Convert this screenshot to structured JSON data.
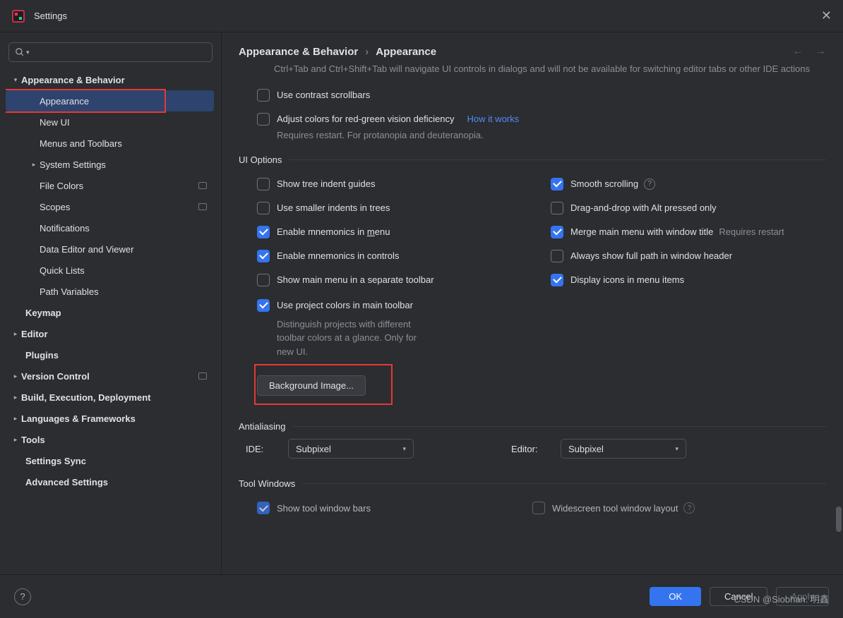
{
  "window": {
    "title": "Settings"
  },
  "breadcrumb": {
    "parent": "Appearance & Behavior",
    "child": "Appearance"
  },
  "sidebar": {
    "items": [
      {
        "label": "Appearance & Behavior"
      },
      {
        "label": "Appearance"
      },
      {
        "label": "New UI"
      },
      {
        "label": "Menus and Toolbars"
      },
      {
        "label": "System Settings"
      },
      {
        "label": "File Colors"
      },
      {
        "label": "Scopes"
      },
      {
        "label": "Notifications"
      },
      {
        "label": "Data Editor and Viewer"
      },
      {
        "label": "Quick Lists"
      },
      {
        "label": "Path Variables"
      },
      {
        "label": "Keymap"
      },
      {
        "label": "Editor"
      },
      {
        "label": "Plugins"
      },
      {
        "label": "Version Control"
      },
      {
        "label": "Build, Execution, Deployment"
      },
      {
        "label": "Languages & Frameworks"
      },
      {
        "label": "Tools"
      },
      {
        "label": "Settings Sync"
      },
      {
        "label": "Advanced Settings"
      }
    ]
  },
  "topHint": "Ctrl+Tab and Ctrl+Shift+Tab will navigate UI controls in dialogs and will not be available for switching editor tabs or other IDE actions",
  "checks": {
    "contrastScrollbars": "Use contrast scrollbars",
    "adjustColors": "Adjust colors for red-green vision deficiency",
    "howItWorks": "How it works",
    "adjustHint": "Requires restart. For protanopia and deuteranopia."
  },
  "sections": {
    "uiOptions": "UI Options",
    "antialiasing": "Antialiasing",
    "toolWindows": "Tool Windows"
  },
  "uiOptions": {
    "left": [
      {
        "label": "Show tree indent guides",
        "checked": false
      },
      {
        "label": "Use smaller indents in trees",
        "checked": false
      },
      {
        "label_pre": "Enable mnemonics in ",
        "underline": "m",
        "label_post": "enu",
        "checked": true
      },
      {
        "label": "Enable mnemonics in controls",
        "checked": true
      },
      {
        "label": "Show main menu in a separate toolbar",
        "checked": false
      },
      {
        "label": "Use project colors in main toolbar",
        "checked": true
      }
    ],
    "projectColorsHint": "Distinguish projects with different toolbar colors at a glance. Only for new UI.",
    "right": [
      {
        "label": "Smooth scrolling",
        "checked": true,
        "help": true
      },
      {
        "label": "Drag-and-drop with Alt pressed only",
        "checked": false
      },
      {
        "label": "Merge main menu with window title",
        "checked": true,
        "suffix": "Requires restart"
      },
      {
        "label": "Always show full path in window header",
        "checked": false
      },
      {
        "label": "Display icons in menu items",
        "checked": true
      }
    ],
    "backgroundImageBtn": "Background Image..."
  },
  "antialiasing": {
    "ideLabel": "IDE:",
    "ideValue": "Subpixel",
    "editorLabel": "Editor:",
    "editorValue": "Subpixel"
  },
  "toolWindows": {
    "showBars": "Show tool window bars",
    "widescreen": "Widescreen tool window layout"
  },
  "footer": {
    "ok": "OK",
    "cancel": "Cancel",
    "apply": "Apply"
  },
  "watermark": "CSDN @Siobhan. 明鑫"
}
